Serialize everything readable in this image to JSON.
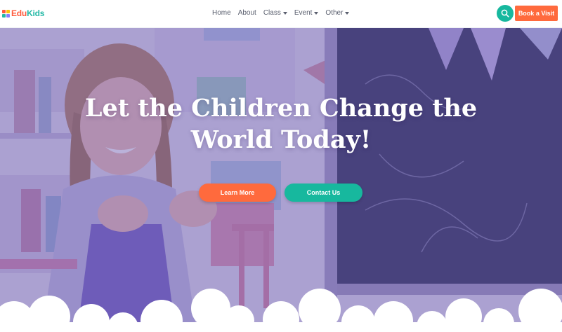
{
  "brand": {
    "part1": "Edu",
    "part2": "Kids"
  },
  "nav": {
    "home": "Home",
    "about": "About",
    "class": "Class",
    "event": "Event",
    "other": "Other"
  },
  "header": {
    "search_icon": "search-icon",
    "cta_label": "Book a Visit"
  },
  "hero": {
    "title": "Let the Children Change the World Today!",
    "primary_button": "Learn More",
    "secondary_button": "Contact Us"
  },
  "colors": {
    "accent_orange": "#ff6a3d",
    "accent_teal": "#17b89e",
    "overlay_purple": "#6a5bb0"
  }
}
